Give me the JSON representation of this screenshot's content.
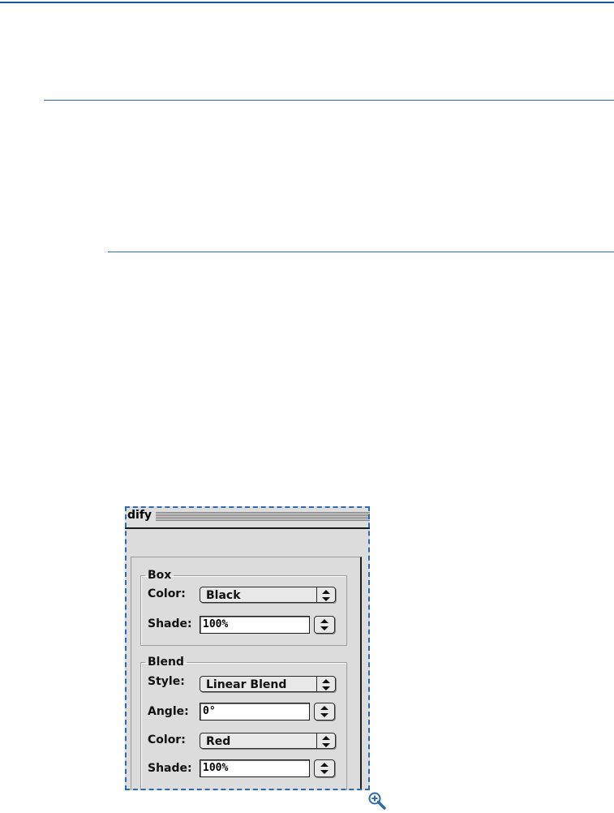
{
  "dialog": {
    "title_fragment": "dify",
    "box_group": {
      "legend": "Box",
      "color_label": "Color:",
      "color_value": "Black",
      "shade_label": "Shade:",
      "shade_value": "100%"
    },
    "blend_group": {
      "legend": "Blend",
      "style_label": "Style:",
      "style_value": "Linear Blend",
      "angle_label": "Angle:",
      "angle_value": "0°",
      "color_label": "Color:",
      "color_value": "Red",
      "shade_label": "Shade:",
      "shade_value": "100%"
    }
  },
  "icons": {
    "zoom": "zoom-in-icon"
  },
  "colors": {
    "rule": "#2d6aa8",
    "crop_border": "#2f6aa8",
    "dialog_bg": "#dcdcdc"
  }
}
